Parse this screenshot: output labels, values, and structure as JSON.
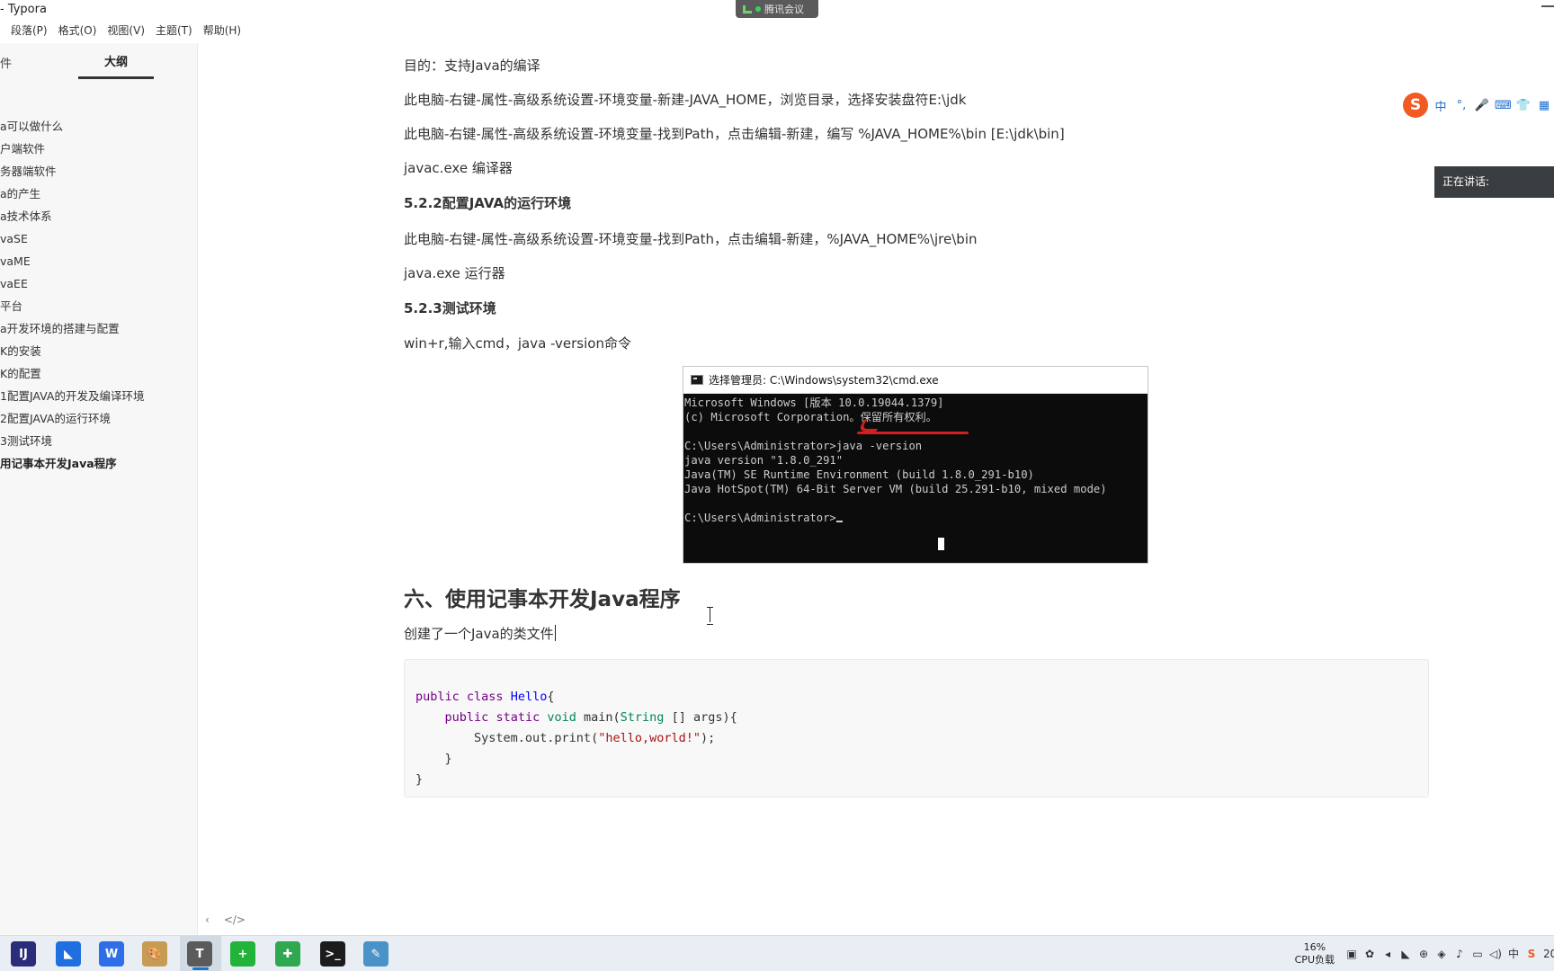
{
  "window": {
    "title": "- Typora",
    "meeting_label": "腾讯会议"
  },
  "menu": [
    "段落(P)",
    "格式(O)",
    "视图(V)",
    "主题(T)",
    "帮助(H)"
  ],
  "sidebar": {
    "tab_files": "件",
    "tab_outline": "大纲",
    "outline": [
      "a可以做什么",
      "户端软件",
      "务器端软件",
      "a的产生",
      "a技术体系",
      "vaSE",
      "vaME",
      "vaEE",
      "平台",
      "a开发环境的搭建与配置",
      "K的安装",
      "K的配置",
      "1配置JAVA的开发及编译环境",
      "2配置JAVA的运行环境",
      "3测试环境",
      "用记事本开发Java程序"
    ],
    "active_index": 15
  },
  "doc": {
    "p1": "目的：支持Java的编译",
    "p2": "此电脑-右键-属性-高级系统设置-环境变量-新建-JAVA_HOME，浏览目录，选择安装盘符E:\\jdk",
    "p3": "此电脑-右键-属性-高级系统设置-环境变量-找到Path，点击编辑-新建，编写 %JAVA_HOME%\\bin   [E:\\jdk\\bin]",
    "p4": "javac.exe 编译器",
    "h522": "5.2.2配置JAVA的运行环境",
    "p5": "此电脑-右键-属性-高级系统设置-环境变量-找到Path，点击编辑-新建，%JAVA_HOME%\\jre\\bin",
    "p6": "java.exe 运行器",
    "h523": "5.2.3测试环境",
    "p7": "win+r,输入cmd，java -version命令",
    "h6": "六、使用记事本开发Java程序",
    "p8": "创建了一个Java的类文件"
  },
  "cmd": {
    "title": "选择管理员: C:\\Windows\\system32\\cmd.exe",
    "lines": [
      "Microsoft Windows [版本 10.0.19044.1379]",
      "(c) Microsoft Corporation。保留所有权利。",
      "",
      "C:\\Users\\Administrator>java -version",
      "java version \"1.8.0_291\"",
      "Java(TM) SE Runtime Environment (build 1.8.0_291-b10)",
      "Java HotSpot(TM) 64-Bit Server VM (build 25.291-b10, mixed mode)",
      "",
      "C:\\Users\\Administrator>"
    ]
  },
  "code": {
    "lines": [
      [
        [
          "kw",
          "public"
        ],
        [
          "",
          " "
        ],
        [
          "kw",
          "class"
        ],
        [
          "",
          " "
        ],
        [
          "def",
          "Hello"
        ],
        [
          "",
          "{"
        ]
      ],
      [
        [
          "",
          "    "
        ],
        [
          "kw",
          "public"
        ],
        [
          "",
          " "
        ],
        [
          "kw",
          "static"
        ],
        [
          "",
          " "
        ],
        [
          "var2",
          "void"
        ],
        [
          "",
          " main("
        ],
        [
          "var2",
          "String"
        ],
        [
          "",
          " [] args){"
        ]
      ],
      [
        [
          "",
          "        System.out.print("
        ],
        [
          "str",
          "\"hello,world!\""
        ],
        [
          "",
          ");"
        ]
      ],
      [
        [
          "",
          "    }"
        ]
      ],
      [
        [
          "",
          "}"
        ]
      ]
    ]
  },
  "ime": {
    "logo": "S",
    "buttons": [
      "中",
      "°,",
      "🎤",
      "⌨",
      "👕",
      "▦"
    ]
  },
  "speaking_label": "正在讲话:",
  "taskbar": {
    "cpu_percent": "16%",
    "cpu_label": "CPU负载",
    "lang": "中",
    "clock_partial": "20",
    "apps": [
      {
        "name": "intellij-idea-icon",
        "glyph": "IJ",
        "color": "#2b2d7a"
      },
      {
        "name": "lark-icon",
        "glyph": "◣",
        "color": "#1f6fe0"
      },
      {
        "name": "wps-icon",
        "glyph": "W",
        "color": "#2d6fe6"
      },
      {
        "name": "paint-icon",
        "glyph": "🎨",
        "color": "#c69b54"
      },
      {
        "name": "typora-icon",
        "glyph": "T",
        "color": "#5b5b5b"
      },
      {
        "name": "green-plus-icon",
        "glyph": "+",
        "color": "#22b33b"
      },
      {
        "name": "xmind-icon",
        "glyph": "✚",
        "color": "#2fa84f"
      },
      {
        "name": "terminal-icon",
        "glyph": ">_",
        "color": "#1c1c1c"
      },
      {
        "name": "notepad-icon",
        "glyph": "✎",
        "color": "#4a93c9"
      }
    ]
  },
  "colors": {
    "sidebar_bg": "#f7f7f7",
    "code_bg": "#f8f8f8",
    "cmd_bg": "#0c0c0c",
    "annotation_red": "#d21f1f",
    "taskbar_bg": "#e8eef3"
  }
}
